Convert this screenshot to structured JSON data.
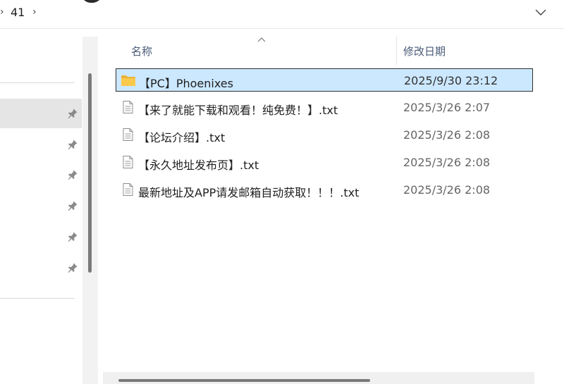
{
  "address_bar": {
    "breadcrumbs": [
      "41"
    ],
    "separator": "›"
  },
  "columns": {
    "name": "名称",
    "date_modified": "修改日期"
  },
  "files": [
    {
      "name": "【PC】Phoenixes",
      "date": "2025/9/30 23:12",
      "type": "folder",
      "selected": true
    },
    {
      "name": "【来了就能下载和观看！纯免费！】.txt",
      "date": "2025/3/26 2:07",
      "type": "text-file",
      "selected": false
    },
    {
      "name": "【论坛介绍】.txt",
      "date": "2025/3/26 2:08",
      "type": "text-file",
      "selected": false
    },
    {
      "name": "【永久地址发布页】.txt",
      "date": "2025/3/26 2:08",
      "type": "text-file",
      "selected": false
    },
    {
      "name": "最新地址及APP请发邮箱自动获取！！！.txt",
      "date": "2025/3/26 2:08",
      "type": "text-file",
      "selected": false
    }
  ],
  "colors": {
    "selection": "#cce8ff",
    "folder": "#f8c94b",
    "header_text": "#4a5a78"
  },
  "icons": {
    "folder": "folder-icon",
    "text_file": "text-file-icon",
    "pin": "pin-icon",
    "sort": "sort-arrow-icon",
    "dropdown": "chevron-down-icon"
  }
}
